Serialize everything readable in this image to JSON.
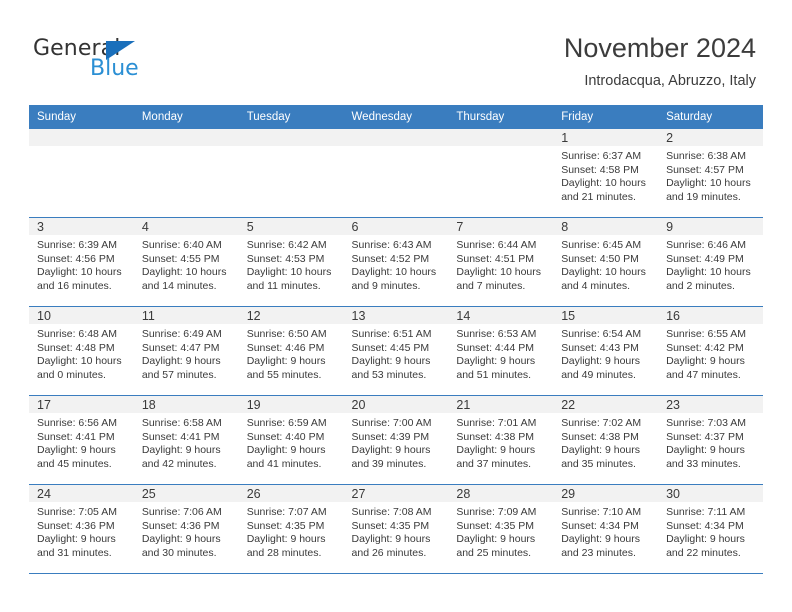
{
  "brand": {
    "name_part1": "General",
    "name_part2": "Blue",
    "triangle_color": "#1a6fbb",
    "blue_color": "#2b8fd4"
  },
  "header": {
    "month_title": "November 2024",
    "location": "Introdacqua, Abruzzo, Italy"
  },
  "theme": {
    "header_row_bg": "#3a7dbf",
    "daynum_strip_bg": "#f2f2f2",
    "grid_line": "#3a7dbf",
    "text": "#3a3a3a"
  },
  "weekdays": [
    "Sunday",
    "Monday",
    "Tuesday",
    "Wednesday",
    "Thursday",
    "Friday",
    "Saturday"
  ],
  "labels": {
    "sunrise": "Sunrise:",
    "sunset": "Sunset:",
    "daylight": "Daylight:"
  },
  "weeks": [
    [
      {
        "day": "",
        "empty": true
      },
      {
        "day": "",
        "empty": true
      },
      {
        "day": "",
        "empty": true
      },
      {
        "day": "",
        "empty": true
      },
      {
        "day": "",
        "empty": true
      },
      {
        "day": "1",
        "sunrise": "Sunrise: 6:37 AM",
        "sunset": "Sunset: 4:58 PM",
        "daylight": "Daylight: 10 hours and 21 minutes."
      },
      {
        "day": "2",
        "sunrise": "Sunrise: 6:38 AM",
        "sunset": "Sunset: 4:57 PM",
        "daylight": "Daylight: 10 hours and 19 minutes."
      }
    ],
    [
      {
        "day": "3",
        "sunrise": "Sunrise: 6:39 AM",
        "sunset": "Sunset: 4:56 PM",
        "daylight": "Daylight: 10 hours and 16 minutes."
      },
      {
        "day": "4",
        "sunrise": "Sunrise: 6:40 AM",
        "sunset": "Sunset: 4:55 PM",
        "daylight": "Daylight: 10 hours and 14 minutes."
      },
      {
        "day": "5",
        "sunrise": "Sunrise: 6:42 AM",
        "sunset": "Sunset: 4:53 PM",
        "daylight": "Daylight: 10 hours and 11 minutes."
      },
      {
        "day": "6",
        "sunrise": "Sunrise: 6:43 AM",
        "sunset": "Sunset: 4:52 PM",
        "daylight": "Daylight: 10 hours and 9 minutes."
      },
      {
        "day": "7",
        "sunrise": "Sunrise: 6:44 AM",
        "sunset": "Sunset: 4:51 PM",
        "daylight": "Daylight: 10 hours and 7 minutes."
      },
      {
        "day": "8",
        "sunrise": "Sunrise: 6:45 AM",
        "sunset": "Sunset: 4:50 PM",
        "daylight": "Daylight: 10 hours and 4 minutes."
      },
      {
        "day": "9",
        "sunrise": "Sunrise: 6:46 AM",
        "sunset": "Sunset: 4:49 PM",
        "daylight": "Daylight: 10 hours and 2 minutes."
      }
    ],
    [
      {
        "day": "10",
        "sunrise": "Sunrise: 6:48 AM",
        "sunset": "Sunset: 4:48 PM",
        "daylight": "Daylight: 10 hours and 0 minutes."
      },
      {
        "day": "11",
        "sunrise": "Sunrise: 6:49 AM",
        "sunset": "Sunset: 4:47 PM",
        "daylight": "Daylight: 9 hours and 57 minutes."
      },
      {
        "day": "12",
        "sunrise": "Sunrise: 6:50 AM",
        "sunset": "Sunset: 4:46 PM",
        "daylight": "Daylight: 9 hours and 55 minutes."
      },
      {
        "day": "13",
        "sunrise": "Sunrise: 6:51 AM",
        "sunset": "Sunset: 4:45 PM",
        "daylight": "Daylight: 9 hours and 53 minutes."
      },
      {
        "day": "14",
        "sunrise": "Sunrise: 6:53 AM",
        "sunset": "Sunset: 4:44 PM",
        "daylight": "Daylight: 9 hours and 51 minutes."
      },
      {
        "day": "15",
        "sunrise": "Sunrise: 6:54 AM",
        "sunset": "Sunset: 4:43 PM",
        "daylight": "Daylight: 9 hours and 49 minutes."
      },
      {
        "day": "16",
        "sunrise": "Sunrise: 6:55 AM",
        "sunset": "Sunset: 4:42 PM",
        "daylight": "Daylight: 9 hours and 47 minutes."
      }
    ],
    [
      {
        "day": "17",
        "sunrise": "Sunrise: 6:56 AM",
        "sunset": "Sunset: 4:41 PM",
        "daylight": "Daylight: 9 hours and 45 minutes."
      },
      {
        "day": "18",
        "sunrise": "Sunrise: 6:58 AM",
        "sunset": "Sunset: 4:41 PM",
        "daylight": "Daylight: 9 hours and 42 minutes."
      },
      {
        "day": "19",
        "sunrise": "Sunrise: 6:59 AM",
        "sunset": "Sunset: 4:40 PM",
        "daylight": "Daylight: 9 hours and 41 minutes."
      },
      {
        "day": "20",
        "sunrise": "Sunrise: 7:00 AM",
        "sunset": "Sunset: 4:39 PM",
        "daylight": "Daylight: 9 hours and 39 minutes."
      },
      {
        "day": "21",
        "sunrise": "Sunrise: 7:01 AM",
        "sunset": "Sunset: 4:38 PM",
        "daylight": "Daylight: 9 hours and 37 minutes."
      },
      {
        "day": "22",
        "sunrise": "Sunrise: 7:02 AM",
        "sunset": "Sunset: 4:38 PM",
        "daylight": "Daylight: 9 hours and 35 minutes."
      },
      {
        "day": "23",
        "sunrise": "Sunrise: 7:03 AM",
        "sunset": "Sunset: 4:37 PM",
        "daylight": "Daylight: 9 hours and 33 minutes."
      }
    ],
    [
      {
        "day": "24",
        "sunrise": "Sunrise: 7:05 AM",
        "sunset": "Sunset: 4:36 PM",
        "daylight": "Daylight: 9 hours and 31 minutes."
      },
      {
        "day": "25",
        "sunrise": "Sunrise: 7:06 AM",
        "sunset": "Sunset: 4:36 PM",
        "daylight": "Daylight: 9 hours and 30 minutes."
      },
      {
        "day": "26",
        "sunrise": "Sunrise: 7:07 AM",
        "sunset": "Sunset: 4:35 PM",
        "daylight": "Daylight: 9 hours and 28 minutes."
      },
      {
        "day": "27",
        "sunrise": "Sunrise: 7:08 AM",
        "sunset": "Sunset: 4:35 PM",
        "daylight": "Daylight: 9 hours and 26 minutes."
      },
      {
        "day": "28",
        "sunrise": "Sunrise: 7:09 AM",
        "sunset": "Sunset: 4:35 PM",
        "daylight": "Daylight: 9 hours and 25 minutes."
      },
      {
        "day": "29",
        "sunrise": "Sunrise: 7:10 AM",
        "sunset": "Sunset: 4:34 PM",
        "daylight": "Daylight: 9 hours and 23 minutes."
      },
      {
        "day": "30",
        "sunrise": "Sunrise: 7:11 AM",
        "sunset": "Sunset: 4:34 PM",
        "daylight": "Daylight: 9 hours and 22 minutes."
      }
    ]
  ]
}
